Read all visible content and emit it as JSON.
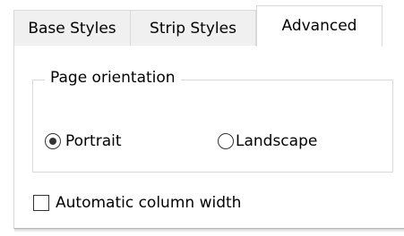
{
  "tabs": [
    {
      "label": "Base Styles",
      "active": false
    },
    {
      "label": "Strip Styles",
      "active": false
    },
    {
      "label": "Advanced",
      "active": true
    }
  ],
  "orientation_group": {
    "label": "Page orientation",
    "options": [
      {
        "label": "Portrait",
        "selected": true
      },
      {
        "label": "Landscape",
        "selected": false
      }
    ]
  },
  "auto_column_width": {
    "label": "Automatic column width",
    "checked": false
  }
}
